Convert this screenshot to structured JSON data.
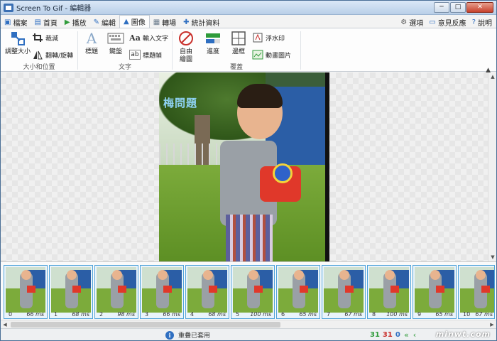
{
  "window": {
    "title": "Screen To Gif - 編輯器",
    "controls": [
      "─",
      "□",
      "✕"
    ]
  },
  "tabs": [
    {
      "label": "檔案",
      "icon": "save-icon"
    },
    {
      "label": "首頁",
      "icon": "home-icon"
    },
    {
      "label": "播放",
      "icon": "play-icon"
    },
    {
      "label": "編輯",
      "icon": "pencil-icon"
    },
    {
      "label": "圖像",
      "icon": "image-icon",
      "active": true
    },
    {
      "label": "轉場",
      "icon": "film-icon"
    },
    {
      "label": "統計資料",
      "icon": "chart-icon"
    }
  ],
  "tab_right": {
    "options": "選項",
    "feedback": "意見反應",
    "help": "說明"
  },
  "ribbon": {
    "size_group": {
      "label": "大小和位置",
      "resize": "調整大小",
      "crop": "裁減",
      "flip_rotate": "翻轉/旋轉"
    },
    "text_group": {
      "label": "文字",
      "caption": "標題",
      "keyboard": "鍵盤",
      "free_text": "輸入文字",
      "title_frame": "標題幀"
    },
    "overlay_group": {
      "label": "覆蓋",
      "free_drawing": "自由繪圖",
      "progress": "進度",
      "border": "邊框",
      "watermark": "浮水印",
      "cinemagraph": "動畫圖片"
    }
  },
  "canvas": {
    "watermark_text": "梅問題"
  },
  "frames": [
    {
      "index": "0",
      "duration": "66 ms"
    },
    {
      "index": "1",
      "duration": "68 ms"
    },
    {
      "index": "2",
      "duration": "98 ms"
    },
    {
      "index": "3",
      "duration": "66 ms"
    },
    {
      "index": "4",
      "duration": "68 ms"
    },
    {
      "index": "5",
      "duration": "100 ms"
    },
    {
      "index": "6",
      "duration": "65 ms"
    },
    {
      "index": "7",
      "duration": "67 ms"
    },
    {
      "index": "8",
      "duration": "100 ms"
    },
    {
      "index": "9",
      "duration": "65 ms"
    },
    {
      "index": "10",
      "duration": "67 ms"
    }
  ],
  "status": {
    "message": "重疊已套用",
    "count_total": "31",
    "count_selected": "31",
    "count_zero": "0",
    "brand": "minwt.com",
    "colors": {
      "total": "#2f9b3a",
      "selected": "#c9302c",
      "zero": "#2f6fc1"
    }
  }
}
